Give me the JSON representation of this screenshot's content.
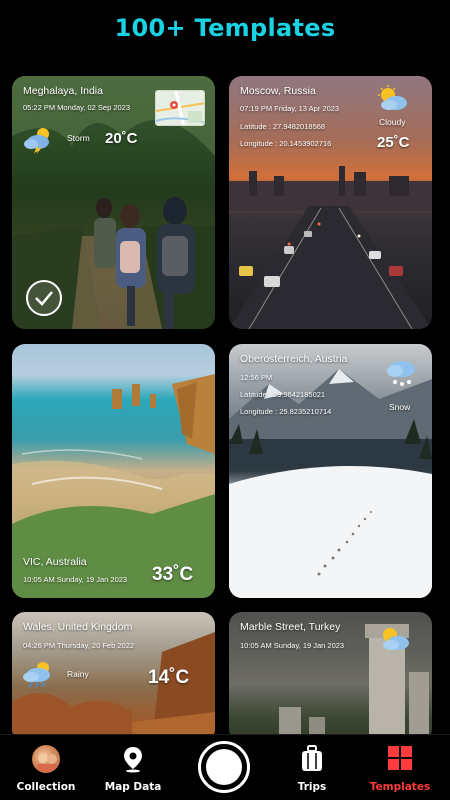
{
  "header": {
    "title": "100+ Templates",
    "accent_color": "#19d3e4"
  },
  "templates": [
    {
      "location": "Meghalaya, India",
      "datetime": "05:22 PM Monday, 02 Sep 2023",
      "condition": "Storm",
      "temperature": "20˚C",
      "icon": "storm-icon",
      "selected": true,
      "has_map": true
    },
    {
      "location": "Moscow, Russia",
      "datetime": "07:19 PM Friday, 13 Apr 2023",
      "latitude": "Latitude : 27.9482018568",
      "longitude": "Longitude : 20.1453902716",
      "condition": "Cloudy",
      "temperature": "25˚C",
      "icon": "cloudy-sun-icon"
    },
    {
      "location": "VIC, Australia",
      "datetime": "10:05 AM Sunday, 19 Jan 2023",
      "temperature": "33˚C"
    },
    {
      "location": "Oberosterreich, Austria",
      "time": "12:56 PM",
      "latitude": "Latitude : 29.9642185021",
      "longitude": "Longitude : 25.8235210714",
      "condition": "Snow",
      "icon": "snow-icon"
    },
    {
      "location": "Wales, United Kingdom",
      "datetime": "04:26 PM Thursday, 20 Feb 2022",
      "condition": "Rainy",
      "temperature": "14˚C",
      "icon": "rainy-icon"
    },
    {
      "location": "Marble Street, Turkey",
      "datetime": "10:05 AM Sunday, 19 Jan 2023",
      "icon": "cloudy-sun-icon"
    }
  ],
  "nav": {
    "items": [
      {
        "label": "Collection",
        "icon": "avatar"
      },
      {
        "label": "Map Data",
        "icon": "map-pin-icon"
      },
      {
        "label": "",
        "icon": "shutter-button"
      },
      {
        "label": "Trips",
        "icon": "suitcase-icon"
      },
      {
        "label": "Templates",
        "icon": "templates-grid-icon",
        "active": true
      }
    ],
    "active_color": "#ff3b3b"
  }
}
